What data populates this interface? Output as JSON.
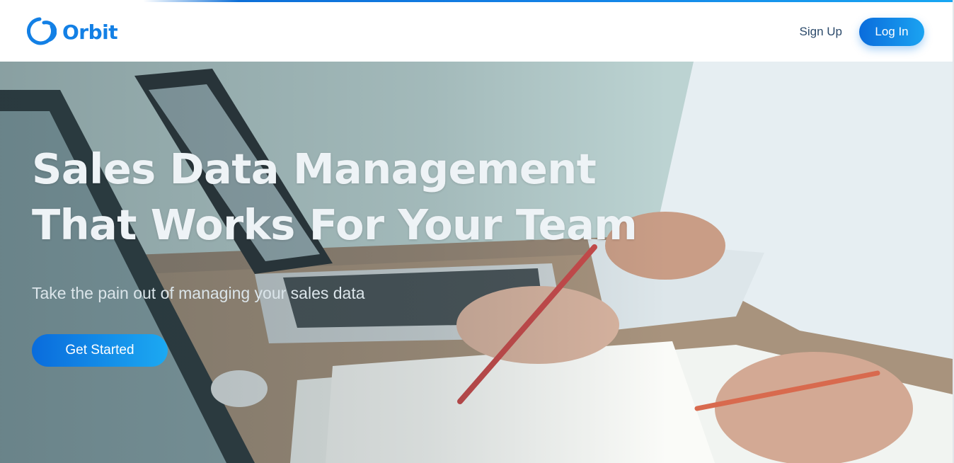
{
  "brand": {
    "name": "Orbit",
    "logo_icon": "orbit-ring-icon",
    "color": "#1380e5"
  },
  "nav": {
    "signup_label": "Sign Up",
    "login_label": "Log In"
  },
  "hero": {
    "title_line1": "Sales Data Management",
    "title_line2": "That Works For Your Team",
    "subtitle": "Take the pain out of managing your sales data",
    "cta_label": "Get Started",
    "background_icon": "office-desk-laptops-photo"
  },
  "colors": {
    "accent": "#1380e5",
    "accent_light": "#1ca9f2",
    "nav_text": "#2c4a6b"
  }
}
